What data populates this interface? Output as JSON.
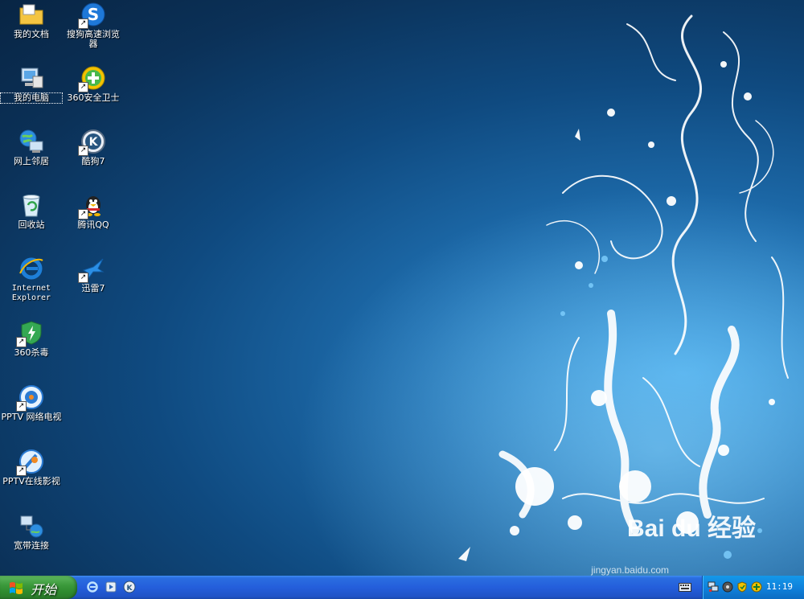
{
  "desktop": {
    "icons": [
      {
        "id": "my-documents",
        "label": "我的文档"
      },
      {
        "id": "sogou-browser",
        "label": "搜狗高速浏览器"
      },
      {
        "id": "my-computer",
        "label": "我的电脑"
      },
      {
        "id": "360-safeguard",
        "label": "360安全卫士"
      },
      {
        "id": "network-neighborhood",
        "label": "网上邻居"
      },
      {
        "id": "kugou7",
        "label": "酷狗7"
      },
      {
        "id": "recycle-bin",
        "label": "回收站"
      },
      {
        "id": "tencent-qq",
        "label": "腾讯QQ"
      },
      {
        "id": "internet-explorer",
        "label": "Internet Explorer"
      },
      {
        "id": "xunlei7",
        "label": "迅雷7"
      },
      {
        "id": "360-antivirus",
        "label": "360杀毒"
      },
      {
        "id": "pptv-network-tv",
        "label": "PPTV 网络电视"
      },
      {
        "id": "pptv-online",
        "label": "PPTV在线影视"
      },
      {
        "id": "broadband",
        "label": "宽带连接"
      }
    ],
    "watermark": "Bai du 经验",
    "watermark_sub": "jingyan.baidu.com"
  },
  "taskbar": {
    "start_label": "开始",
    "quick_launch": [
      "internet-explorer-icon",
      "media-player-icon",
      "kugou-icon"
    ],
    "tray": {
      "time": "11:19"
    }
  },
  "colors": {
    "taskbar": "#245edb",
    "start": "#3c9a3c",
    "tray": "#0f7ed8",
    "desktop": "#0f4a80"
  }
}
